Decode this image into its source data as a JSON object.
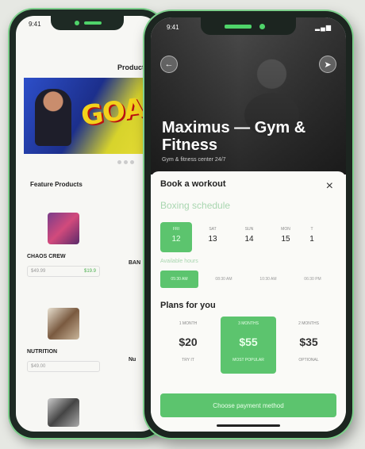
{
  "back_phone": {
    "status_time": "9:41",
    "products_title": "Products",
    "banner_text": "GOAL",
    "feature_title": "Feature Products",
    "products": [
      {
        "name": "CHAOS CREW",
        "price": "$49.99",
        "tag": "$19.9"
      },
      {
        "name": "NUTRITION",
        "price": "$49.00",
        "tag": ""
      }
    ],
    "partial_labels": [
      "BAN",
      "Nu"
    ]
  },
  "front_phone": {
    "status_time": "9:41",
    "status_signal": "▂▄▆",
    "gym_name": "Maximus — Gym & Fitness",
    "gym_subtitle": "Gym & fitness center 24/7",
    "booking": {
      "title": "Book a workout",
      "close": "×",
      "schedule_title": "Boxing schedule",
      "dates": [
        {
          "dow": "FRI",
          "num": "12",
          "selected": true
        },
        {
          "dow": "SAT",
          "num": "13",
          "selected": false
        },
        {
          "dow": "SUN",
          "num": "14",
          "selected": false
        },
        {
          "dow": "MON",
          "num": "15",
          "selected": false
        },
        {
          "dow": "T",
          "num": "1",
          "selected": false
        }
      ],
      "hours_label": "Available hours",
      "hours": [
        {
          "label": "05:30 AM",
          "selected": true
        },
        {
          "label": "08:30 AM",
          "selected": false
        },
        {
          "label": "10:30 AM",
          "selected": false
        },
        {
          "label": "06:30 PM",
          "selected": false
        }
      ],
      "plans_title": "Plans for you",
      "plans": [
        {
          "duration": "1 MONTH",
          "price": "$20",
          "note": "TRY IT",
          "selected": false
        },
        {
          "duration": "3 MONTHS",
          "price": "$55",
          "note": "MOST POPULAR",
          "selected": true
        },
        {
          "duration": "2 MONTHS",
          "price": "$35",
          "note": "OPTIONAL",
          "selected": false
        }
      ],
      "pay_button": "Choose payment method"
    }
  },
  "colors": {
    "accent": "#5cc46e",
    "accent_light": "#a9d6b0",
    "phone_frame": "#1c2520"
  }
}
